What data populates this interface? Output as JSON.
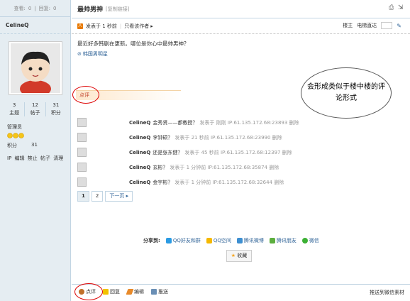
{
  "sidebar": {
    "views_label": "查看:",
    "views": "0",
    "replies_label": "回复:",
    "replies": "0",
    "username": "CelineQ",
    "stats": [
      {
        "num": "3",
        "label": "主题"
      },
      {
        "num": "12",
        "label": "帖子"
      },
      {
        "num": "31",
        "label": "积分"
      }
    ],
    "role": "管理员",
    "credit_label": "积分",
    "credit_value": "31",
    "admin_links": [
      "IP",
      "编辑",
      "禁止",
      "帖子",
      "清理"
    ]
  },
  "post": {
    "title": "最帅男神",
    "copy_link": "[复制链接]",
    "published": "发表于 1 秒前",
    "only_author": "只看该作者",
    "floor_label": "楼主",
    "jump_label": "电梯直达",
    "body": "最近好多韩剧在更新。哪位是你心中最帅男神？",
    "tag": "韩国男明星"
  },
  "callout": "会形成类似于楼中楼的评论形式",
  "dianping_label": "点评",
  "comments": [
    {
      "user": "CelineQ",
      "text": "金秀贤——都教授？",
      "meta": "发表于 刚刚 IP:61.135.172.68:23893 删除"
    },
    {
      "user": "CelineQ",
      "text": "李钟硕？",
      "meta": "发表于 21 秒前 IP:61.135.172.68:23990 删除"
    },
    {
      "user": "CelineQ",
      "text": "还是张东健？",
      "meta": "发表于 45 秒前 IP:61.135.172.68:12397 删除"
    },
    {
      "user": "CelineQ",
      "text": "玄彬？",
      "meta": "发表于 1 分钟前 IP:61.135.172.68:35874 删除"
    },
    {
      "user": "CelineQ",
      "text": "金宇彬？",
      "meta": "发表于 1 分钟前 IP:61.135.172.68:32644 删除"
    }
  ],
  "pager": {
    "page1": "1",
    "page2": "2",
    "next": "下一页"
  },
  "share": {
    "label": "分享到:",
    "items": [
      "QQ好友和群",
      "QQ空间",
      "腾讯微博",
      "腾讯朋友",
      "微信"
    ]
  },
  "favorite": "收藏",
  "bottom": {
    "dianping": "点评",
    "reply": "回复",
    "edit": "编辑",
    "push": "推送",
    "wechat": "推送到微信素材"
  },
  "colors": {
    "accent": "#369",
    "sidebar_bg": "#e5edf2",
    "highlight_ring": "#d00"
  }
}
